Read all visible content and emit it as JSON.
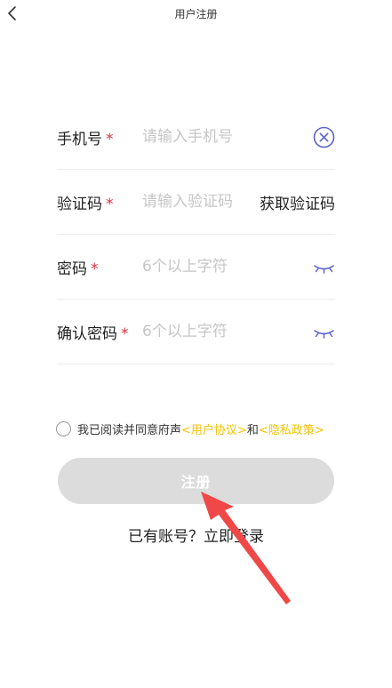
{
  "header": {
    "title": "用户注册",
    "back_icon": "chevron-left-icon"
  },
  "form": {
    "phone": {
      "label": "手机号",
      "required_mark": "*",
      "placeholder": "请输入手机号",
      "value": ""
    },
    "code": {
      "label": "验证码",
      "required_mark": "*",
      "placeholder": "请输入验证码",
      "value": "",
      "get_code_label": "获取验证码"
    },
    "password": {
      "label": "密码",
      "required_mark": "*",
      "placeholder": "6个以上字符",
      "value": ""
    },
    "confirm_password": {
      "label": "确认密码",
      "required_mark": "*",
      "placeholder": "6个以上字符",
      "value": ""
    }
  },
  "agreement": {
    "checked": false,
    "prefix": "我已阅读并同意府声",
    "user_agreement": "<用户协议>",
    "joiner": "和",
    "privacy_policy": "<隐私政策>"
  },
  "register_button": {
    "label": "注册"
  },
  "login_link": {
    "label": "已有账号？立即登录"
  },
  "colors": {
    "required": "#e0303a",
    "icon_accent": "#5b63c9",
    "link": "#f2c200",
    "button_disabled": "#dcdcdc",
    "annotation_arrow": "#f04848"
  }
}
